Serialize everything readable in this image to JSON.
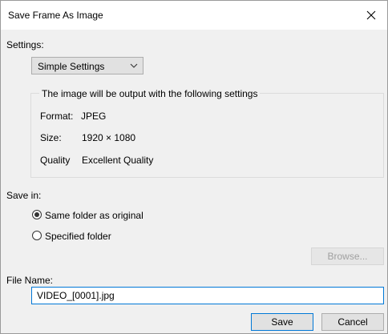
{
  "dialog": {
    "title": "Save Frame As Image",
    "close_icon": "close-icon"
  },
  "settings": {
    "label": "Settings:",
    "mode_selected": "Simple Settings",
    "group_title": "The image will be output with the following settings",
    "format_label": "Format:",
    "format_value": "JPEG",
    "size_label": "Size:",
    "size_value": "1920 × 1080",
    "quality_label": "Quality",
    "quality_value": "Excellent Quality"
  },
  "save_in": {
    "label": "Save in:",
    "options": [
      {
        "label": "Same folder as original",
        "checked": true
      },
      {
        "label": "Specified folder",
        "checked": false
      }
    ],
    "browse_label": "Browse..."
  },
  "file_name": {
    "label": "File Name:",
    "value": "VIDEO_[0001].jpg"
  },
  "buttons": {
    "save_label": "Save",
    "cancel_label": "Cancel"
  },
  "colors": {
    "accent": "#0078d7",
    "dialog_bg": "#f0f0f0",
    "titlebar_bg": "#ffffff"
  }
}
